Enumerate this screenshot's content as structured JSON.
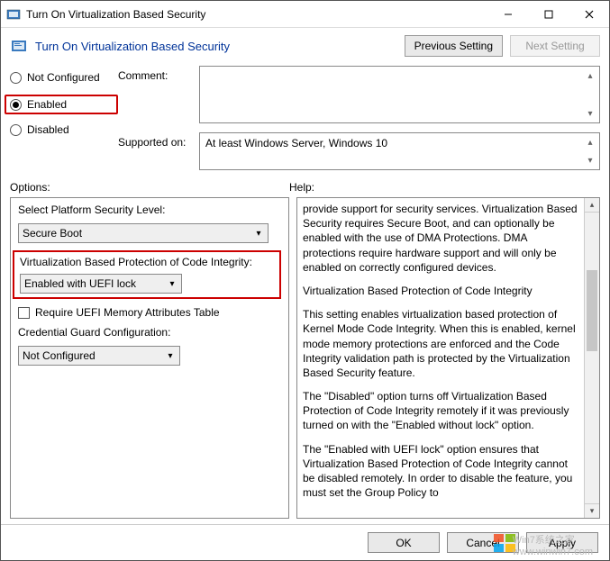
{
  "titlebar": {
    "title": "Turn On Virtualization Based Security"
  },
  "header": {
    "title": "Turn On Virtualization Based Security",
    "prev_button": "Previous Setting",
    "next_button": "Next Setting"
  },
  "state_radios": {
    "not_configured": "Not Configured",
    "enabled": "Enabled",
    "disabled": "Disabled",
    "selected": "enabled"
  },
  "labels": {
    "comment": "Comment:",
    "supported_on": "Supported on:",
    "options": "Options:",
    "help": "Help:"
  },
  "supported_on_value": "At least Windows Server, Windows 10",
  "options": {
    "platform_label": "Select Platform Security Level:",
    "platform_value": "Secure Boot",
    "vbpci_label": "Virtualization Based Protection of Code Integrity:",
    "vbpci_value": "Enabled with UEFI lock",
    "uefi_mat_label": "Require UEFI Memory Attributes Table",
    "credguard_label": "Credential Guard Configuration:",
    "credguard_value": "Not Configured"
  },
  "help_text": {
    "p1": "provide support for security services. Virtualization Based Security requires Secure Boot, and can optionally be enabled with the use of DMA Protections. DMA protections require hardware support and will only be enabled on correctly configured devices.",
    "p2": "Virtualization Based Protection of Code Integrity",
    "p3": "This setting enables virtualization based protection of Kernel Mode Code Integrity. When this is enabled, kernel mode memory protections are enforced and the Code Integrity validation path is protected by the Virtualization Based Security feature.",
    "p4": "The \"Disabled\" option turns off Virtualization Based Protection of Code Integrity remotely if it was previously turned on with the \"Enabled without lock\" option.",
    "p5": "The \"Enabled with UEFI lock\" option ensures that Virtualization Based Protection of Code Integrity cannot be disabled remotely. In order to disable the feature, you must set the Group Policy to"
  },
  "footer": {
    "ok": "OK",
    "cancel": "Cancel",
    "apply": "Apply"
  },
  "watermark": {
    "line1": "Win7系统之家",
    "line2": "www.winwin7.com"
  }
}
